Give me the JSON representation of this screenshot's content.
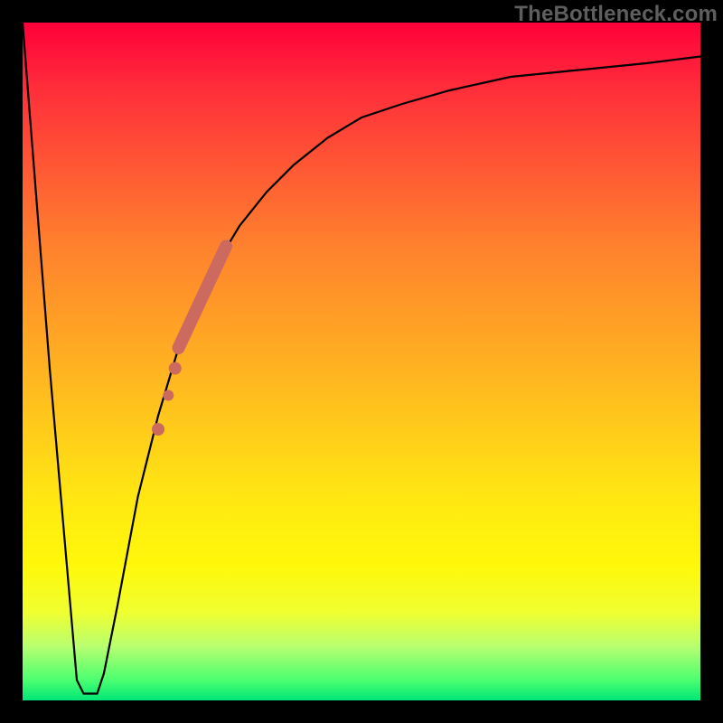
{
  "watermark": "TheBottleneck.com",
  "chart_data": {
    "type": "line",
    "title": "",
    "xlabel": "",
    "ylabel": "",
    "xlim": [
      0,
      100
    ],
    "ylim": [
      0,
      100
    ],
    "grid": false,
    "legend": false,
    "background_gradient": {
      "direction": "vertical",
      "bottom": "green",
      "top": "red",
      "stops": [
        {
          "pos": 0,
          "color": "#00e676"
        },
        {
          "pos": 0.03,
          "color": "#4bff70"
        },
        {
          "pos": 0.08,
          "color": "#b8ff70"
        },
        {
          "pos": 0.13,
          "color": "#f0ff30"
        },
        {
          "pos": 0.2,
          "color": "#fff80a"
        },
        {
          "pos": 0.3,
          "color": "#ffe712"
        },
        {
          "pos": 0.42,
          "color": "#ffc61c"
        },
        {
          "pos": 0.55,
          "color": "#ffa225"
        },
        {
          "pos": 0.68,
          "color": "#ff7e2e"
        },
        {
          "pos": 0.78,
          "color": "#ff5a34"
        },
        {
          "pos": 0.9,
          "color": "#ff2f3a"
        },
        {
          "pos": 1.0,
          "color": "#ff003a"
        }
      ]
    },
    "series": [
      {
        "name": "bottleneck-curve",
        "color": "#000000",
        "x": [
          0,
          4,
          8,
          9,
          10,
          11,
          12,
          14,
          17,
          20,
          23,
          26,
          29,
          32,
          36,
          40,
          45,
          50,
          56,
          63,
          72,
          82,
          92,
          100
        ],
        "y": [
          100,
          49,
          3,
          1,
          1,
          1,
          4,
          14,
          30,
          42,
          52,
          59,
          65,
          70,
          75,
          79,
          83,
          86,
          88,
          90,
          92,
          93,
          94,
          95
        ]
      }
    ],
    "highlight": {
      "color": "#cc6a5f",
      "segment": {
        "x": [
          23,
          30
        ],
        "y": [
          52,
          67
        ]
      },
      "points": [
        {
          "x": 22.5,
          "y": 49
        },
        {
          "x": 21.5,
          "y": 45
        },
        {
          "x": 20.0,
          "y": 40
        }
      ]
    }
  }
}
